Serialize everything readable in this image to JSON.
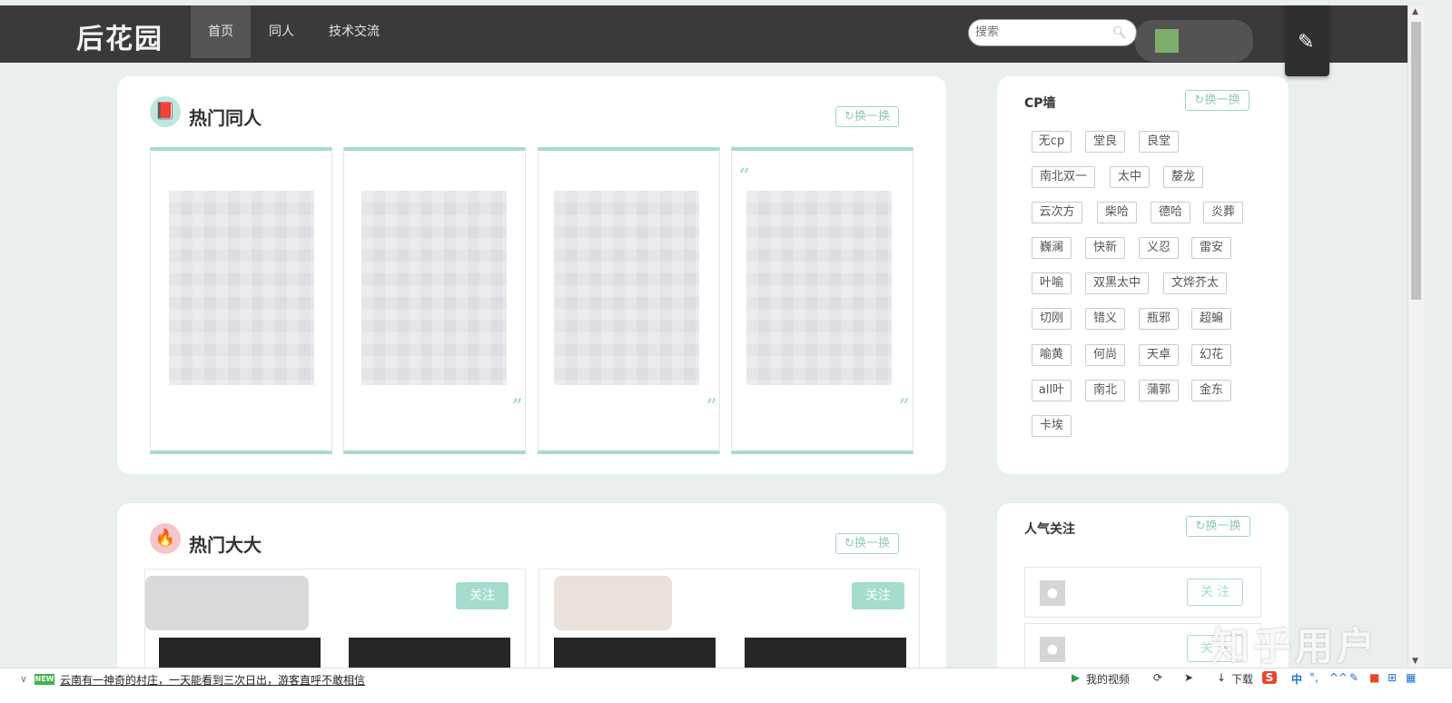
{
  "nav": {
    "logo": "后花园",
    "items": [
      "首页",
      "同人",
      "技术交流"
    ],
    "search_placeholder": "搜索",
    "search_icon": "search-icon",
    "write_icon": "brush-icon"
  },
  "hot_doujin": {
    "title": "热门同人",
    "swap_label": "换一换"
  },
  "hot_artists": {
    "title": "热门大大",
    "swap_label": "换一换",
    "follow_label": "关注"
  },
  "cp_wall": {
    "title": "CP墙",
    "swap_label": "换一换",
    "tags": [
      "无cp",
      "堂良",
      "良堂",
      "南北双一",
      "太中",
      "嫠龙",
      "云次方",
      "柴哈",
      "德哈",
      "炎葬",
      "巍澜",
      "快新",
      "义忍",
      "雷安",
      "叶喻",
      "双黑太中",
      "文烨芥太",
      "切刚",
      "错义",
      "瓶邪",
      "超蝙",
      "喻黄",
      "何尚",
      "天卓",
      "幻花",
      "all叶",
      "南北",
      "蒲郭",
      "金东",
      "卡埃"
    ]
  },
  "popular_follow": {
    "title": "人气关注",
    "swap_label": "换一换",
    "follow_label": "关 注"
  },
  "watermark": "知乎用户",
  "statusbar": {
    "new_badge": "NEW",
    "news": "云南有一神奇的村庄，一天能看到三次日出，游客直呼不敢相信",
    "video": "我的视频",
    "download": "下载",
    "ime": "中"
  }
}
